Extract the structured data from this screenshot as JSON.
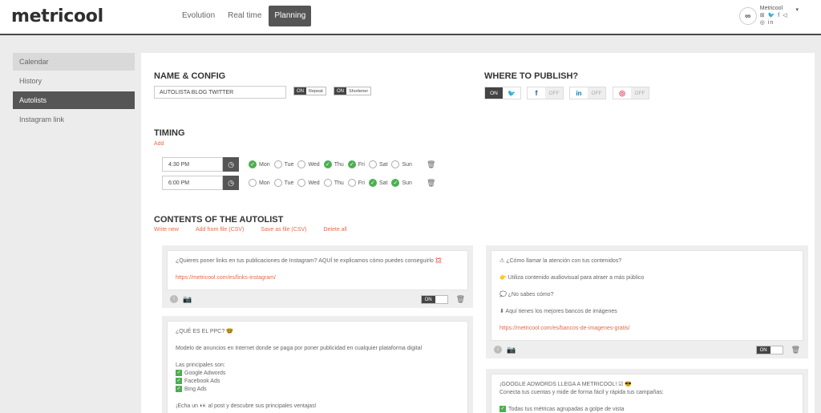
{
  "brand": {
    "logo_text": "metricool"
  },
  "nav": {
    "tabs": [
      {
        "label": "Evolution"
      },
      {
        "label": "Real time"
      },
      {
        "label": "Planning"
      }
    ]
  },
  "profile": {
    "name": "Metricool",
    "avatar_text": "∞",
    "social_icons": "⊞ 🐦 f ◁",
    "social_icons_2": "◎ in"
  },
  "sidebar": {
    "items": [
      {
        "label": "Calendar"
      },
      {
        "label": "History"
      },
      {
        "label": "Autolists"
      },
      {
        "label": "Instagram link"
      }
    ]
  },
  "name_config": {
    "title": "NAME & CONFIG",
    "name_value": "AUTOLISTA BLOG TWITTER",
    "repeat": {
      "state": "ON",
      "label": "Repeat"
    },
    "shortener": {
      "state": "ON",
      "label": "Shortener"
    }
  },
  "publish": {
    "title": "WHERE TO PUBLISH?",
    "networks": [
      {
        "name": "twitter",
        "state": "ON",
        "icon": "🐦",
        "color": "#1da1f2"
      },
      {
        "name": "facebook",
        "state": "OFF",
        "icon": "f",
        "color": "#3b5998"
      },
      {
        "name": "linkedin",
        "state": "OFF",
        "icon": "in",
        "color": "#0077b5"
      },
      {
        "name": "instagram",
        "state": "OFF",
        "icon": "◎",
        "color": "#e4405f"
      }
    ]
  },
  "timing": {
    "title": "TIMING",
    "add_label": "Add",
    "day_labels": [
      "Mon",
      "Tue",
      "Wed",
      "Thu",
      "Fri",
      "Sat",
      "Sun"
    ],
    "rows": [
      {
        "time": "4:30 PM",
        "days": [
          true,
          false,
          false,
          true,
          true,
          false,
          false
        ]
      },
      {
        "time": "6:00 PM",
        "days": [
          false,
          false,
          false,
          false,
          false,
          true,
          true
        ]
      }
    ]
  },
  "contents": {
    "title": "CONTENTS OF THE AUTOLIST",
    "actions": [
      "Write new",
      "Add from file (CSV)",
      "Save as file (CSV)",
      "Delete all"
    ],
    "cards": [
      {
        "lines": [
          "¿Quieres poner links en tus publicaciones de Instagram? AQUÍ te explicamos cómo puedes conseguirlo 💢"
        ],
        "url": "https://metricool.com/es/links-instagram/",
        "toggle": "ON"
      },
      {
        "lines": [
          "⚠ ¿Cómo llamar la atención con tus contenidos?",
          "👉 Utiliza contenido audiovisual para atraer a más público",
          "💭 ¿No sabes cómo?",
          "⬇ Aquí tienes los mejores bancos de imágenes"
        ],
        "url": "https://metricool.com/es/bancos-de-imagenes-gratis/",
        "toggle": "ON"
      },
      {
        "title": "¿QUÉ ES EL PPC? 🤓",
        "intro": "Modelo de anuncios en Internet donde se paga por poner publicidad en cualquier plataforma digital",
        "list_heading": "Las principales son:",
        "items": [
          "Google Adwords",
          "Facebook Ads",
          "Bing Ads"
        ],
        "cta": "¡Echa un 👀 al post y descubre sus principales ventajas!"
      },
      {
        "title": "¡GOOGLE ADWORDS LLEGA A METRICOOL! ☑ 😎",
        "intro": "Conecta tus cuentas y mide de forma fácil y rápida tus campañas:",
        "items": [
          "Todas tus métricas agrupadas a golpe de vista"
        ]
      }
    ]
  },
  "colors": {
    "accent": "#e46a4a",
    "dark": "#555555",
    "check": "#4caf50"
  }
}
